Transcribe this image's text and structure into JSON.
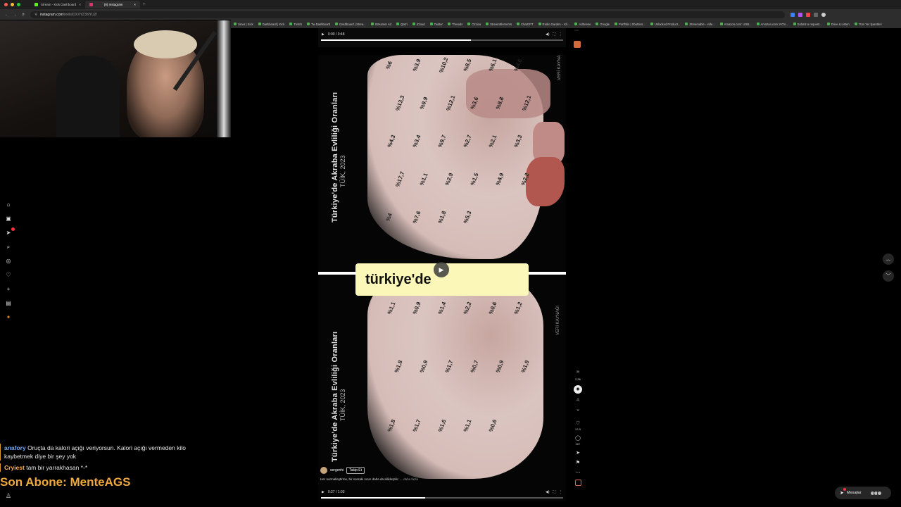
{
  "browser": {
    "tabs": [
      {
        "label": "Stream - Kick Dashboard",
        "active": false
      },
      {
        "label": "(9) Instagram",
        "active": true
      }
    ],
    "url_host": "instagram.com",
    "url_path": "/reels/DXXYZ3hlYU2/",
    "bookmarks": [
      "zimer | Kick",
      "Dashboard | Kick",
      "Twitch",
      "Tw Dashboard",
      "Dashboard | Strea...",
      "Streamer Ad",
      "Qatzi",
      "iCloud",
      "Twitter",
      "Threads",
      "Ozzica",
      "StreamElements",
      "ChatGPT",
      "Radio Garden – Kli...",
      "AdSense",
      "Google",
      "Portfolio | Shutters...",
      "Unlocked Product...",
      "Streamable - vide...",
      "Amazon.com: USB...",
      "Amazon.com: NOV...",
      "Submit a request...",
      "Drive & Listen",
      "Tüm Yer İşaretleri"
    ]
  },
  "chat": [
    {
      "user": "anafory",
      "message": "Oruçta da kalori açığı veriyorsun. Kalori açığı vermeden kilo kaybetmek diye bir şey yok"
    },
    {
      "user": "Cryiest",
      "message": "tam bir yarrakhasan *-*"
    }
  ],
  "overlay": {
    "last_sub": "Son Abone: MenteAGS"
  },
  "video_top": {
    "time": "0:00 / 0:48"
  },
  "video": {
    "map_title": "Türkiye'de Akraba Evliliği Oranları",
    "map_subtitle": "TÜİK, 2023",
    "map_source": "VERİ KAYNAĞI",
    "caption": "türkiye'de",
    "author": "sergenhi",
    "follow": "Takip Et",
    "description": "Her normalleştirme, bir sonraki sınırı daha da silikleştirir. ...",
    "more": "daha fazla",
    "time": "0:27 / 1:03",
    "progress": 0.43
  },
  "map_values": [
    "%6",
    "%3,9",
    "%10,2",
    "%8,5",
    "%6,1",
    "%4,6",
    "%13,3",
    "%9,9",
    "%12,1",
    "%3,6",
    "%8,8",
    "%12,1",
    "%4,3",
    "%3,4",
    "%9,7",
    "%2,7",
    "%2,1",
    "%3,3",
    "%17,7",
    "%1,1",
    "%2,9",
    "%1,5",
    "%4,9",
    "%2,2",
    "%4",
    "%7,6",
    "%1,8",
    "%5,3"
  ],
  "map_values_lower": [
    "%1,1",
    "%0,9",
    "%1,4",
    "%2,2",
    "%0,6",
    "%1,2",
    "%1,8",
    "%0,9",
    "%1,7",
    "%0,7",
    "%0,9",
    "%1,9",
    "%1,8",
    "%1,7",
    "%1,6",
    "%1,1",
    "%0,6"
  ],
  "actions": {
    "likes": "10 B",
    "comments": "587",
    "side_counts": [
      "30",
      "2,36"
    ]
  },
  "messages": {
    "label": "Mesajlar",
    "badge": "9"
  }
}
